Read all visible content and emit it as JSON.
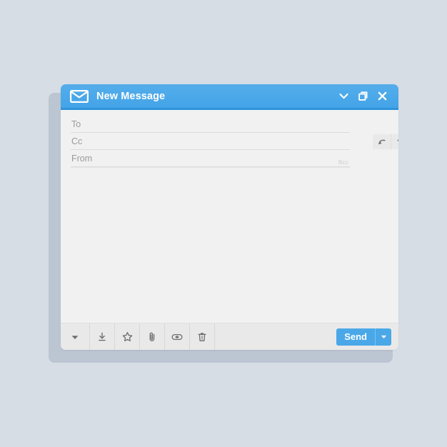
{
  "window": {
    "title": "New Message",
    "icon": "envelope-icon",
    "title_buttons": [
      {
        "name": "minimize-button",
        "icon": "chevron-down-icon"
      },
      {
        "name": "restore-button",
        "icon": "restore-window-icon"
      },
      {
        "name": "close-button",
        "icon": "close-icon"
      }
    ]
  },
  "fields": [
    {
      "name": "to-field",
      "label": "To",
      "value": "",
      "placeholder": "To"
    },
    {
      "name": "cc-field",
      "label": "Cc",
      "value": "",
      "placeholder": "Cc"
    },
    {
      "name": "from-field",
      "label": "From",
      "value": "",
      "placeholder": "From"
    }
  ],
  "bcc_label": "Bcc",
  "action_group": [
    {
      "name": "undo-button",
      "icon": "undo-arrow-icon"
    },
    {
      "name": "redo-button",
      "icon": "redo-arrow-icon"
    },
    {
      "name": "copy-button",
      "icon": "copy-icon"
    },
    {
      "name": "info-button",
      "icon": "info-circle-icon"
    }
  ],
  "body": {
    "value": "",
    "placeholder": ""
  },
  "bottom_toolbar": [
    {
      "name": "formatting-button",
      "icon": "triangle-down-icon"
    },
    {
      "name": "save-draft-button",
      "icon": "download-icon"
    },
    {
      "name": "star-button",
      "icon": "star-icon"
    },
    {
      "name": "attach-button",
      "icon": "paperclip-icon"
    },
    {
      "name": "link-button",
      "icon": "link-icon"
    },
    {
      "name": "discard-button",
      "icon": "trash-icon"
    }
  ],
  "send": {
    "label": "Send",
    "dropdown_icon": "triangle-down-icon"
  },
  "colors": {
    "page_background": "#d6dde5",
    "window_shadow": "#bcc6d2",
    "header_blue": "#4aa8e8",
    "header_blue_dark": "#2f93dc",
    "body_gray": "#f1f1f1",
    "toolbar_gray": "#e9e9e9",
    "label_gray": "#9a9a9a",
    "icon_gray": "#6d6d6d",
    "send_blue": "#4aa8e8"
  }
}
